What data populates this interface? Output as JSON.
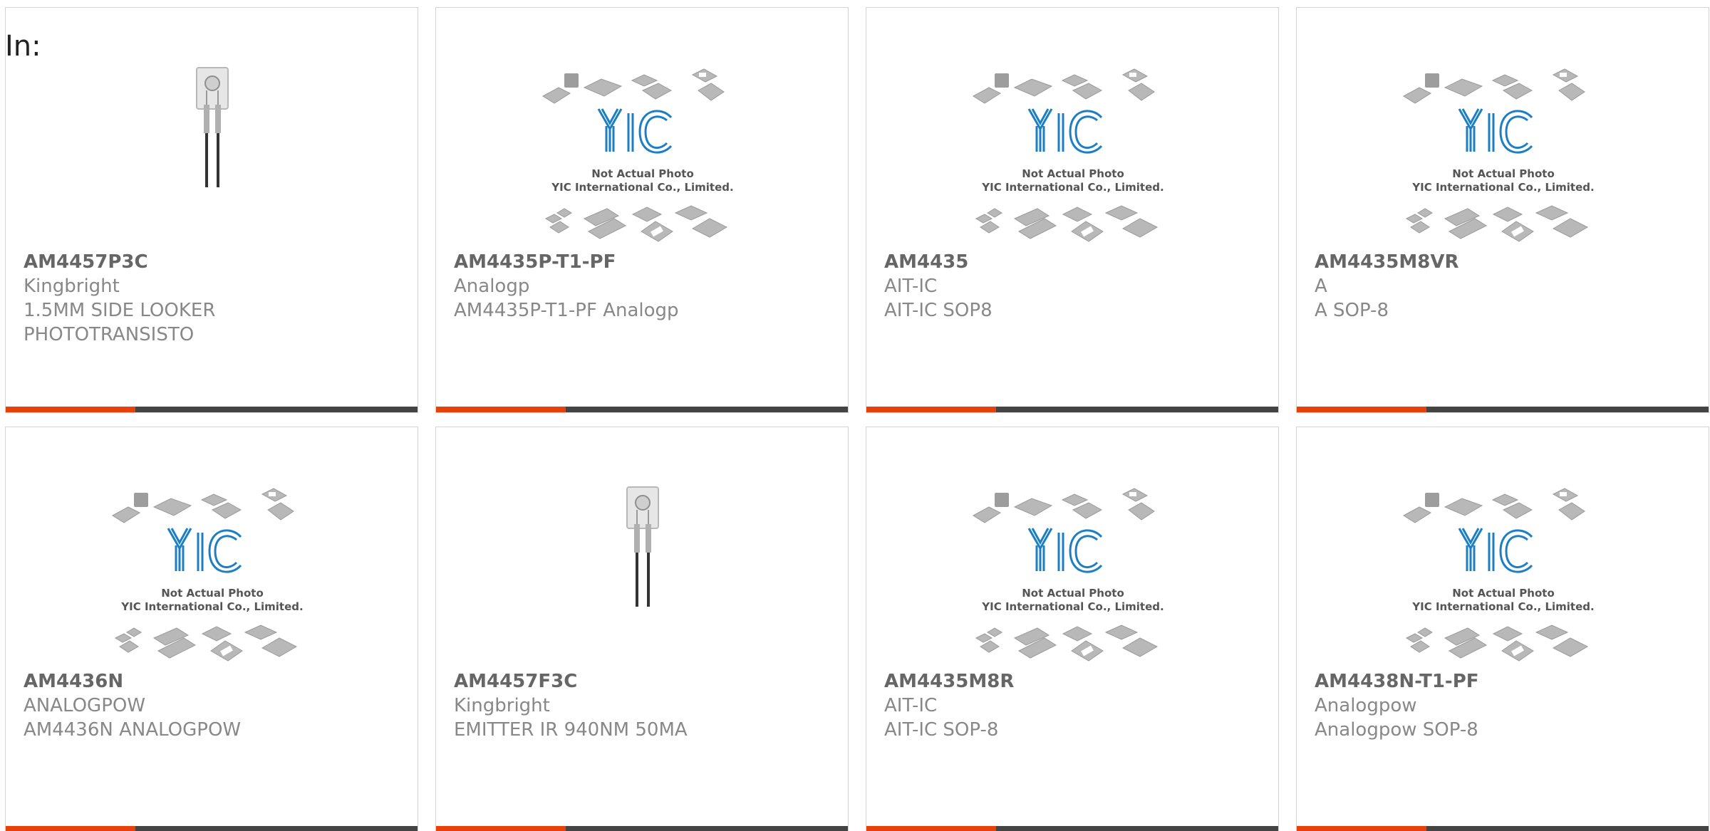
{
  "header": {
    "label": "In:"
  },
  "placeholder": {
    "line1": "Not Actual Photo",
    "line2": "YIC International Co., Limited."
  },
  "colors": {
    "accent": "#e8400a",
    "bar": "#444444",
    "yic_logo": "#1d7fc3",
    "border": "#d4d4d4"
  },
  "products": [
    {
      "part": "AM4457P3C",
      "maker": "Kingbright",
      "desc": "1.5MM SIDE LOOKER",
      "desc2": "PHOTOTRANSISTO",
      "image": "side-looker-photo"
    },
    {
      "part": "AM4435P-T1-PF",
      "maker": "Analogp",
      "desc": "AM4435P-T1-PF Analogp",
      "desc2": "",
      "image": "not-actual-photo-placeholder"
    },
    {
      "part": "AM4435",
      "maker": "AIT-IC",
      "desc": "AIT-IC SOP8",
      "desc2": "",
      "image": "not-actual-photo-placeholder"
    },
    {
      "part": "AM4435M8VR",
      "maker": "A",
      "desc": "A SOP-8",
      "desc2": "",
      "image": "not-actual-photo-placeholder"
    },
    {
      "part": "AM4436N",
      "maker": "ANALOGPOW",
      "desc": "AM4436N ANALOGPOW",
      "desc2": "",
      "image": "not-actual-photo-placeholder"
    },
    {
      "part": "AM4457F3C",
      "maker": "Kingbright",
      "desc": "EMITTER IR 940NM 50MA",
      "desc2": "",
      "image": "side-looker-photo"
    },
    {
      "part": "AM4435M8R",
      "maker": "AIT-IC",
      "desc": "AIT-IC SOP-8",
      "desc2": "",
      "image": "not-actual-photo-placeholder"
    },
    {
      "part": "AM4438N-T1-PF",
      "maker": "Analogpow",
      "desc": "Analogpow SOP-8",
      "desc2": "",
      "image": "not-actual-photo-placeholder"
    }
  ]
}
